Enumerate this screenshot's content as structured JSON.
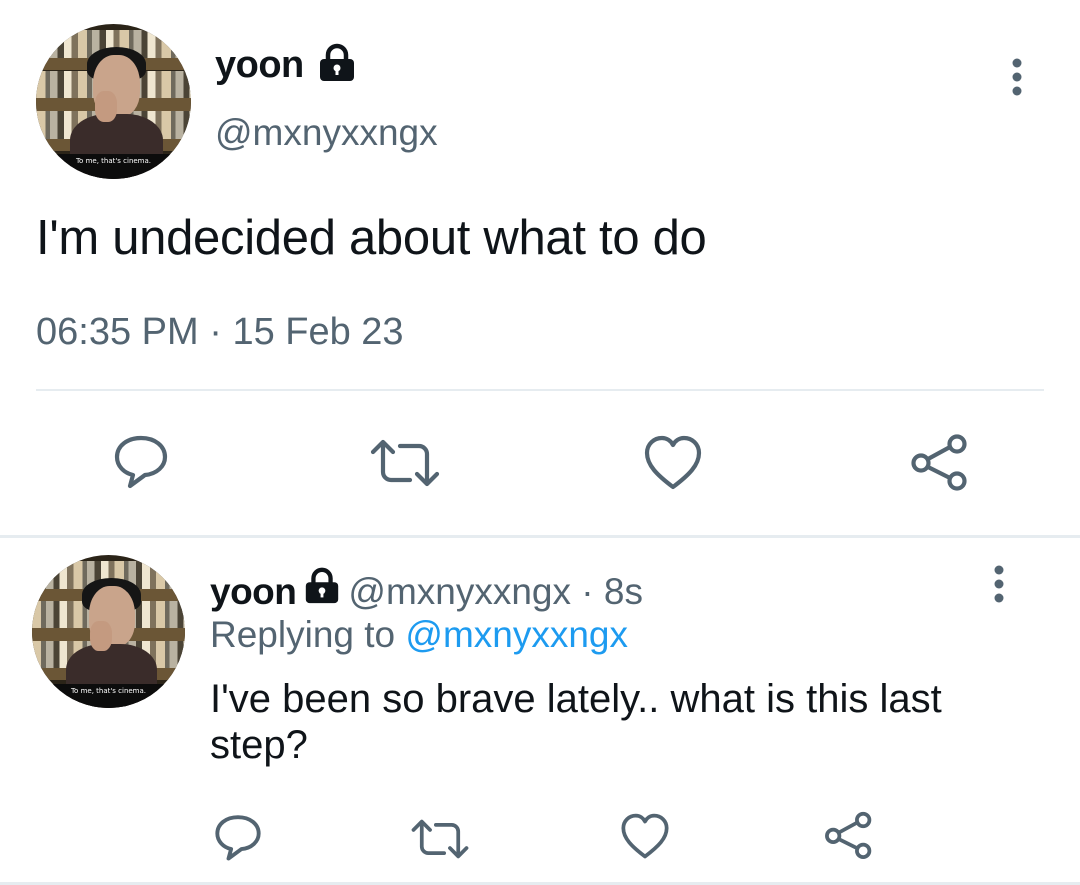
{
  "main_tweet": {
    "avatar_caption": "To me, that's cinema.",
    "display_name": "yoon",
    "handle": "@mxnyxxngx",
    "text": "I'm undecided about what to do",
    "time": "06:35 PM",
    "separator": "·",
    "date": "15 Feb 23",
    "icons": {
      "lock": "lock-icon",
      "more": "more-vertical-icon",
      "reply": "reply-icon",
      "retweet": "retweet-icon",
      "like": "heart-icon",
      "share": "share-icon"
    }
  },
  "reply_tweet": {
    "avatar_caption": "To me, that's cinema.",
    "display_name": "yoon",
    "handle": "@mxnyxxngx",
    "separator": "·",
    "age": "8s",
    "replying_prefix": "Replying to",
    "replying_to": "@mxnyxxngx",
    "text": "I've been so brave lately.. what is this last step?"
  },
  "colors": {
    "text": "#0f1419",
    "secondary": "#536471",
    "link": "#1d9bf0",
    "divider": "#e6ecf0"
  }
}
